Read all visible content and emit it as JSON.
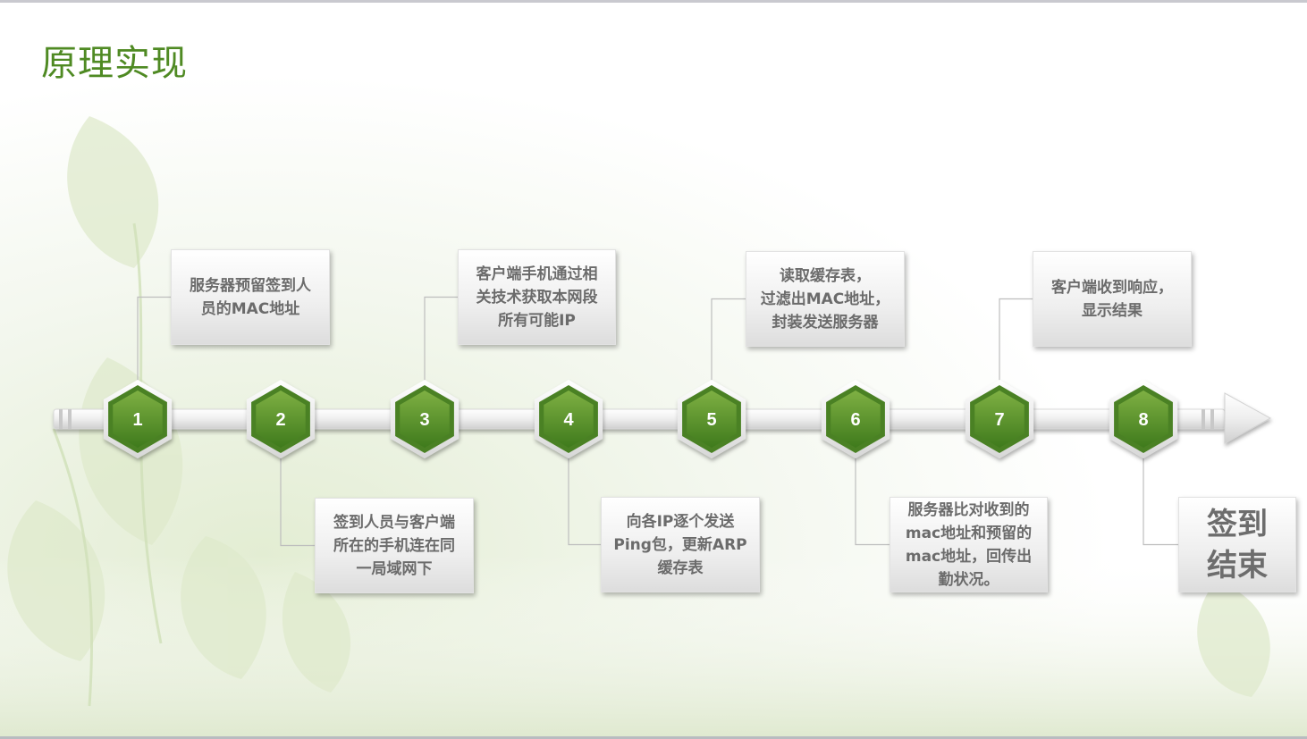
{
  "title": "原理实现",
  "colors": {
    "hex_outer": "#4a8124",
    "hex_inner_top": "#7fb043",
    "hex_inner_bottom": "#3f7a1c",
    "title": "#4f8a23",
    "box_text": "#6b6b6b",
    "connector": "#bdbdbd"
  },
  "steps": [
    {
      "number": "1",
      "text": "服务器预留签到人员的MAC地址",
      "lines": [
        "服务器预留签到人",
        "员的MAC地址"
      ],
      "side": "top"
    },
    {
      "number": "2",
      "text": "签到人员与客户端所在的手机连在同一局域网下",
      "lines": [
        "签到人员与客户端",
        "所在的手机连在同",
        "一局域网下"
      ],
      "side": "bottom"
    },
    {
      "number": "3",
      "text": "客户端手机通过相关技术获取本网段所有可能IP",
      "lines": [
        "客户端手机通过相",
        "关技术获取本网段",
        "所有可能IP"
      ],
      "side": "top"
    },
    {
      "number": "4",
      "text": "向各IP逐个发送Ping包，更新ARP缓存表",
      "lines": [
        "向各IP逐个发送",
        "Ping包，更新ARP",
        "缓存表"
      ],
      "side": "bottom"
    },
    {
      "number": "5",
      "text": "读取缓存表，过滤出MAC地址，封装发送服务器",
      "lines": [
        "读取缓存表，",
        "过滤出MAC地址，",
        "封装发送服务器"
      ],
      "side": "top"
    },
    {
      "number": "6",
      "text": "服务器比对收到的mac地址和预留的mac地址，回传出勤状况。",
      "lines": [
        "服务器比对收到的",
        "mac地址和预留的",
        "mac地址，回传出",
        "勤状况。"
      ],
      "side": "bottom"
    },
    {
      "number": "7",
      "text": "客户端收到响应，显示结果",
      "lines": [
        "客户端收到响应，",
        "显示结果"
      ],
      "side": "top"
    },
    {
      "number": "8",
      "text": "签到结束",
      "lines": [
        "签到",
        "结束"
      ],
      "side": "bottom"
    }
  ]
}
